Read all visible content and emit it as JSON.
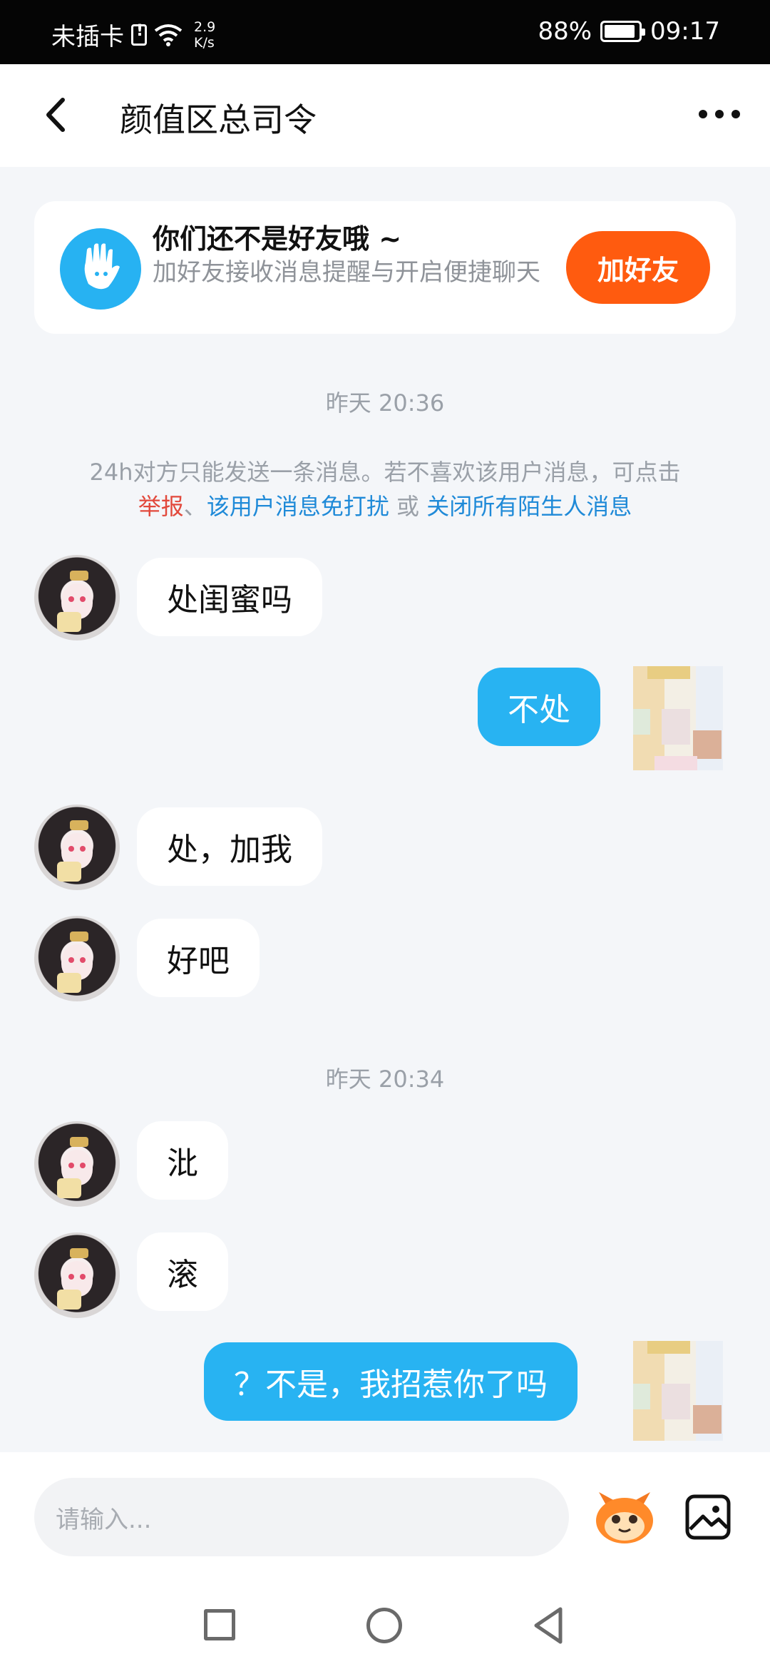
{
  "status_bar": {
    "carrier": "未插卡",
    "speed_value": "2.9",
    "speed_unit": "K/s",
    "battery": "88%",
    "time": "09:17"
  },
  "header": {
    "title": "颜值区总司令"
  },
  "friend_card": {
    "title": "你们还不是好友哦 ~",
    "subtitle": "加好友接收消息提醒与开启便捷聊天",
    "button": "加好友"
  },
  "time_labels": [
    "昨天 20:36",
    "昨天 20:34"
  ],
  "notice": {
    "text": "24h对方只能发送一条消息。若不喜欢该用户消息，可点击",
    "report": "举报",
    "sep": "、",
    "mute_user": "该用户消息免打扰",
    "or": " 或 ",
    "close_all": "关闭所有陌生人消息"
  },
  "messages": [
    {
      "side": "in",
      "text": "处闺蜜吗"
    },
    {
      "side": "out",
      "text": "不处"
    },
    {
      "side": "in",
      "text": "处，加我"
    },
    {
      "side": "in",
      "text": "好吧"
    },
    {
      "side": "in",
      "text": "沘"
    },
    {
      "side": "in",
      "text": "滚"
    },
    {
      "side": "out",
      "text": "？不是，我招惹你了吗"
    }
  ],
  "input": {
    "placeholder": "请输入..."
  },
  "colors": {
    "accent_blue": "#28b3f2",
    "add_friend_orange": "#ff5b0f",
    "report_red": "#e2493c",
    "link_blue": "#1f8ad8"
  },
  "icons": [
    "back-icon",
    "more-icon",
    "hand-icon",
    "emoji-icon",
    "image-icon",
    "nav-recents-icon",
    "nav-home-icon",
    "nav-back-icon"
  ]
}
